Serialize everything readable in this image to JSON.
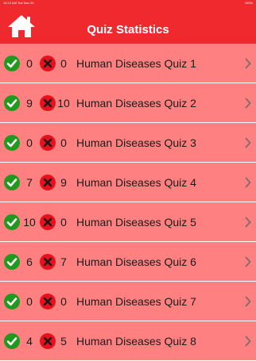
{
  "status_bar": {
    "time": "10:12 AM  Tue Nov 20",
    "right": "100%"
  },
  "header": {
    "title": "Quiz Statistics"
  },
  "icons": {
    "home": "home-icon",
    "correct": "checkmark-circle-icon",
    "wrong": "x-circle-icon",
    "disclosure": "chevron-right-icon"
  },
  "colors": {
    "header_bg": "#f0292e",
    "list_bg": "#ff8080",
    "correct": "#1f9a1f",
    "wrong": "#e8101c"
  },
  "quizzes": [
    {
      "correct": "0",
      "wrong": "0",
      "name": "Human Diseases Quiz 1"
    },
    {
      "correct": "9",
      "wrong": "10",
      "name": "Human Diseases Quiz 2"
    },
    {
      "correct": "0",
      "wrong": "0",
      "name": "Human Diseases Quiz 3"
    },
    {
      "correct": "7",
      "wrong": "9",
      "name": "Human Diseases Quiz 4"
    },
    {
      "correct": "10",
      "wrong": "0",
      "name": "Human Diseases Quiz 5"
    },
    {
      "correct": "6",
      "wrong": "7",
      "name": "Human Diseases Quiz 6"
    },
    {
      "correct": "0",
      "wrong": "0",
      "name": "Human Diseases Quiz 7"
    },
    {
      "correct": "4",
      "wrong": "5",
      "name": "Human Diseases Quiz 8"
    }
  ]
}
